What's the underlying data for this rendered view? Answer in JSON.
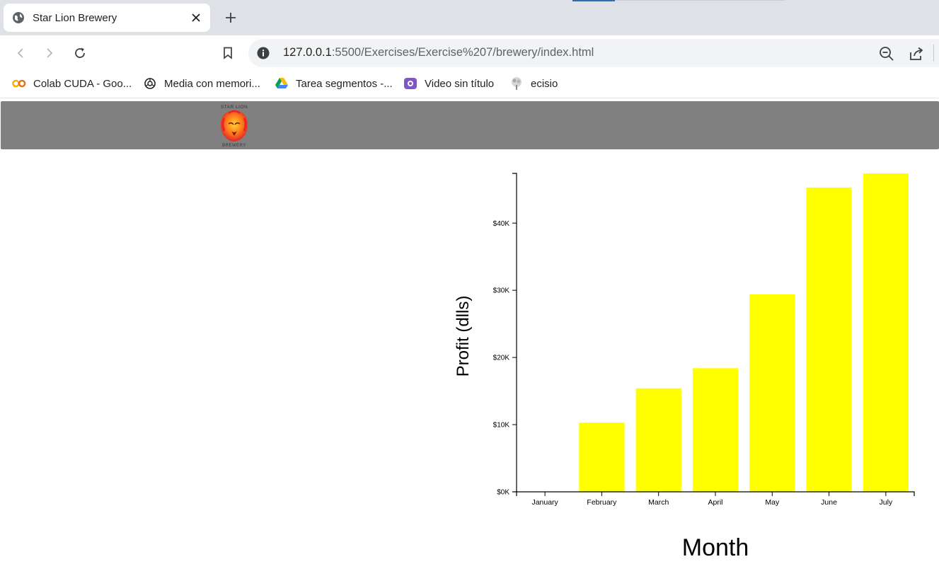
{
  "browser": {
    "tab": {
      "title": "Star Lion Brewery"
    },
    "url": {
      "host": "127.0.0.1",
      "path": ":5500/Exercises/Exercise%207/brewery/index.html"
    },
    "bookmarks": [
      {
        "label": "Colab CUDA - Goo...",
        "icon": "colab-icon"
      },
      {
        "label": "Media con memori...",
        "icon": "openai-icon"
      },
      {
        "label": "Tarea segmentos -...",
        "icon": "drive-icon"
      },
      {
        "label": "Video sin título",
        "icon": "video-icon"
      },
      {
        "label": "ecisio",
        "icon": "tree-icon"
      }
    ]
  },
  "header": {
    "logo_top_text": "STAR LION",
    "logo_bottom_text": "BREWERY",
    "background": "#808080"
  },
  "chart_data": {
    "type": "bar",
    "categories": [
      "January",
      "February",
      "March",
      "April",
      "May",
      "June",
      "July"
    ],
    "values": [
      0,
      10300,
      15400,
      18400,
      29400,
      45300,
      47400
    ],
    "bar_color": "#ffff00",
    "xlabel": "Month",
    "ylabel": "Profit (dlls)",
    "y_ticks": [
      0,
      10000,
      20000,
      30000,
      40000
    ],
    "y_tick_labels": [
      "$0K",
      "$10K",
      "$20K",
      "$30K",
      "$40K"
    ],
    "ylim": [
      0,
      47400
    ],
    "grid": false
  }
}
